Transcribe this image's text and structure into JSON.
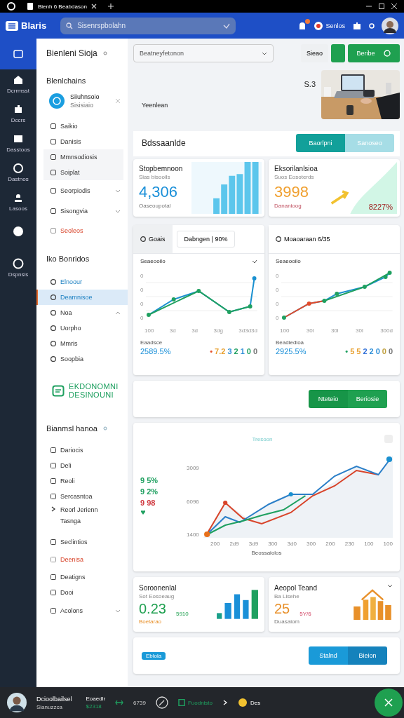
{
  "browser": {
    "tab_title": "Bienh 6 Beabdason"
  },
  "header": {
    "logo": "Blaris",
    "search": {
      "placeholder": "Sisenrspbolahn"
    },
    "has_notification": true,
    "status": "Senlos"
  },
  "rail": [
    {
      "selected": true
    },
    {
      "label": "Dcrrmsst",
      "selected": false
    },
    {
      "label": "Dccrs",
      "selected": false
    },
    {
      "label": "Dasstoos",
      "selected": false
    },
    {
      "label": "Dastnos",
      "selected": false
    },
    {
      "label": "Lasoos",
      "selected": false
    },
    {
      "selected": false
    },
    {
      "label": "Dspnsis",
      "selected": false
    }
  ],
  "sidebar": {
    "title": "Bienleni Sioja",
    "section_1": "Blenlchains",
    "profile": {
      "name": "Siiuhnsoio",
      "sub": "Sisisiaio"
    },
    "items_1": [
      {
        "label": "Saikio",
        "kind": "normal"
      },
      {
        "label": "Danisis",
        "kind": "normal"
      },
      {
        "label": "Mmnsodiosis",
        "kind": "grouped"
      },
      {
        "label": "Soiplat",
        "kind": "grouped"
      },
      {
        "label": "Seorpiodis",
        "kind": "dropdown"
      },
      {
        "label": "Sisongvia",
        "kind": "dropdown"
      },
      {
        "label": "Seoleos",
        "kind": "alert"
      }
    ],
    "section_2": "Iko Bonridos",
    "items_2": [
      {
        "label": "Elnoour",
        "kind": "link",
        "selected": false
      },
      {
        "label": "Deamnisoe",
        "kind": "link",
        "selected": true
      },
      {
        "label": "Noa",
        "kind": "expanded",
        "selected": false
      },
      {
        "label": "Uorpho",
        "kind": "normal",
        "selected": false
      },
      {
        "label": "Mmris",
        "kind": "normal",
        "selected": false
      },
      {
        "label": "Soopbia",
        "kind": "normal",
        "selected": false
      }
    ],
    "brand": [
      "EKDONOMNI",
      "DESINOUNI"
    ],
    "section_3": "Bianmsl hanoa",
    "items_3": [
      {
        "label": "Dariocis",
        "kind": "normal"
      },
      {
        "label": "Deli",
        "kind": "normal"
      },
      {
        "label": "Reoli",
        "kind": "normal"
      },
      {
        "label": "Sercasntoa",
        "kind": "normal"
      },
      {
        "label": "Reorl Jerienn",
        "sub": "Tasnga",
        "kind": "arrow"
      },
      {
        "label": "Seclintios",
        "kind": "normal"
      },
      {
        "label": "Deenisa",
        "kind": "alert"
      },
      {
        "label": "Deatigns",
        "kind": "normal"
      },
      {
        "label": "Dooi",
        "kind": "normal"
      },
      {
        "label": "Acolons",
        "kind": "dropdown"
      }
    ]
  },
  "toolbar": {
    "dropdown": "Beatneyfetonon",
    "buttons": [
      "Sieao",
      "Beribe"
    ]
  },
  "hero": {
    "number": "S.3",
    "label": "Yeenlean"
  },
  "overview": {
    "title": "Bdssaanlde",
    "tabs": [
      {
        "label": "Baorlpni",
        "selected": true
      },
      {
        "label": "Sanoseo",
        "selected": false
      }
    ]
  },
  "kpis": [
    {
      "kind": "bars",
      "title": "Stopbemnoon",
      "sub": "Sias bisooils",
      "value": "4,306",
      "note": "Oaseoupotal"
    },
    {
      "kind": "area",
      "title": "Eksorilanlsioa",
      "sub": "Suos Eosoterds",
      "value": "3998",
      "note": "Dananioog",
      "badge": "8227%"
    }
  ],
  "charts": [
    {
      "tabs": [
        {
          "label": "Goais",
          "selected": true
        },
        {
          "label": "Dabngen | 90%",
          "selected": false
        }
      ],
      "label": "Seaeooilo",
      "y_ticks": [
        "0",
        "0",
        "0",
        "0"
      ],
      "x_ticks": [
        "100",
        "3d",
        "3d",
        "3dg",
        "3d3d3d"
      ],
      "footer_label": "Eaadsce",
      "footer_value": "2589.5%",
      "legend": [
        {
          "text": "•",
          "color": "#e8542f"
        },
        {
          "text": "7.2",
          "color": "#e8a02f"
        },
        {
          "text": "3",
          "color": "#2f8fd8"
        },
        {
          "text": "2",
          "color": "#1fa060"
        },
        {
          "text": "1",
          "color": "#2f8fd8"
        },
        {
          "text": "0",
          "color": "#1fa060"
        },
        {
          "text": "0",
          "color": "#777777"
        }
      ]
    },
    {
      "tabs": [
        {
          "label": "Moaoaraan 6/35",
          "selected": true
        }
      ],
      "label": "Seaeooilo",
      "y_ticks": [
        "0",
        "0",
        "0",
        "0"
      ],
      "x_ticks": [
        "100",
        "30l",
        "30l",
        "30l",
        "300d"
      ],
      "footer_label": "Beadiedioa",
      "footer_value": "2925.5%",
      "legend": [
        {
          "text": "•",
          "color": "#1fa060"
        },
        {
          "text": "5",
          "color": "#e8a02f"
        },
        {
          "text": "5",
          "color": "#e8a02f"
        },
        {
          "text": "2",
          "color": "#2f6fd8"
        },
        {
          "text": "2",
          "color": "#2f8fd8"
        },
        {
          "text": "0",
          "color": "#2f8fd8"
        },
        {
          "text": "0",
          "color": "#c0a040"
        },
        {
          "text": "0",
          "color": "#777777"
        }
      ]
    }
  ],
  "action_bar": {
    "buttons": [
      "Nteteio",
      "Beriosie"
    ]
  },
  "trend": {
    "legend": "Tresoon",
    "stats": [
      {
        "text": "9 5%",
        "color": "#1fa060"
      },
      {
        "text": "9 2%",
        "color": "#1fa060"
      },
      {
        "text": "9 98",
        "color": "#d0383f"
      }
    ],
    "y_ticks": [
      "3009",
      "6096",
      "1400"
    ],
    "x_ticks": [
      "200",
      "2d9",
      "3d9",
      "300",
      "3d0",
      "300",
      "200",
      "230",
      "100",
      "100"
    ],
    "x_title": "Beossaiolos"
  },
  "small_cards": [
    {
      "kind": "bars",
      "title": "Soroonenlal",
      "sub": "Sot Eosoeaug",
      "value": "0.23",
      "note": "Boelarao",
      "delta": "5910"
    },
    {
      "kind": "house",
      "title": "Aeopol Teand",
      "sub": "Ba Lisehe",
      "value": "25",
      "note": "Duasaiom",
      "delta": "5Y/6"
    }
  ],
  "bottom_bar": {
    "tag": "Eblola",
    "buttons": [
      "Stalnd",
      "Bieion"
    ]
  },
  "footer": {
    "user": "Dcioolbailsel",
    "user_sub": "Sianuzzca",
    "info": "Eoaedlr",
    "info_sub": "$2318",
    "count": "6739",
    "task": "Fuodnisto",
    "coin": "Des"
  }
}
